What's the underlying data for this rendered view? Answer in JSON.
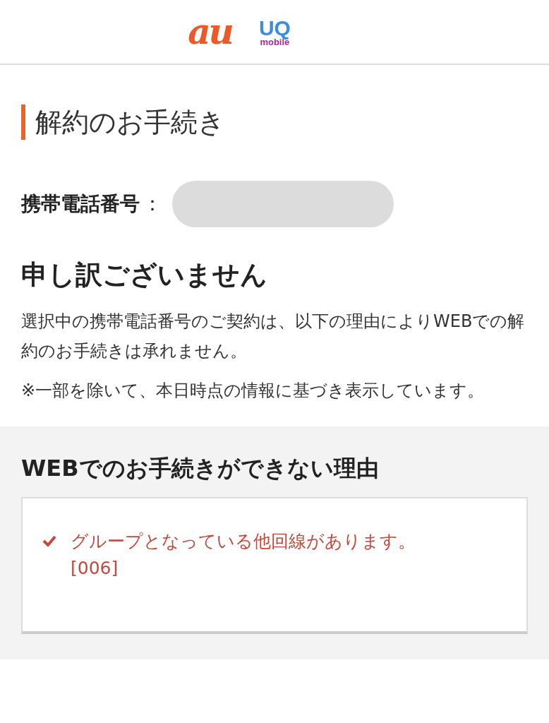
{
  "header": {
    "logos": [
      {
        "kind": "au",
        "text": "au"
      },
      {
        "kind": "uq",
        "text": "UQ",
        "subtext": "mobile"
      }
    ]
  },
  "page_title": "解約のお手続き",
  "phone": {
    "label": "携帯電話番号",
    "separator": "：",
    "redacted": true
  },
  "heading": "申し訳ございません",
  "paragraphs": [
    "選択中の携帯電話番号のご契約は、以下の理由によりWEBでの解約のお手続きは承れません。",
    "※一部を除いて、本日時点の情報に基づき表示しています。"
  ],
  "reasons": {
    "title": "WEBでのお手続きができない理由",
    "items": [
      {
        "message": "グループとなっている他回線があります。",
        "code": "[006]"
      }
    ]
  }
}
